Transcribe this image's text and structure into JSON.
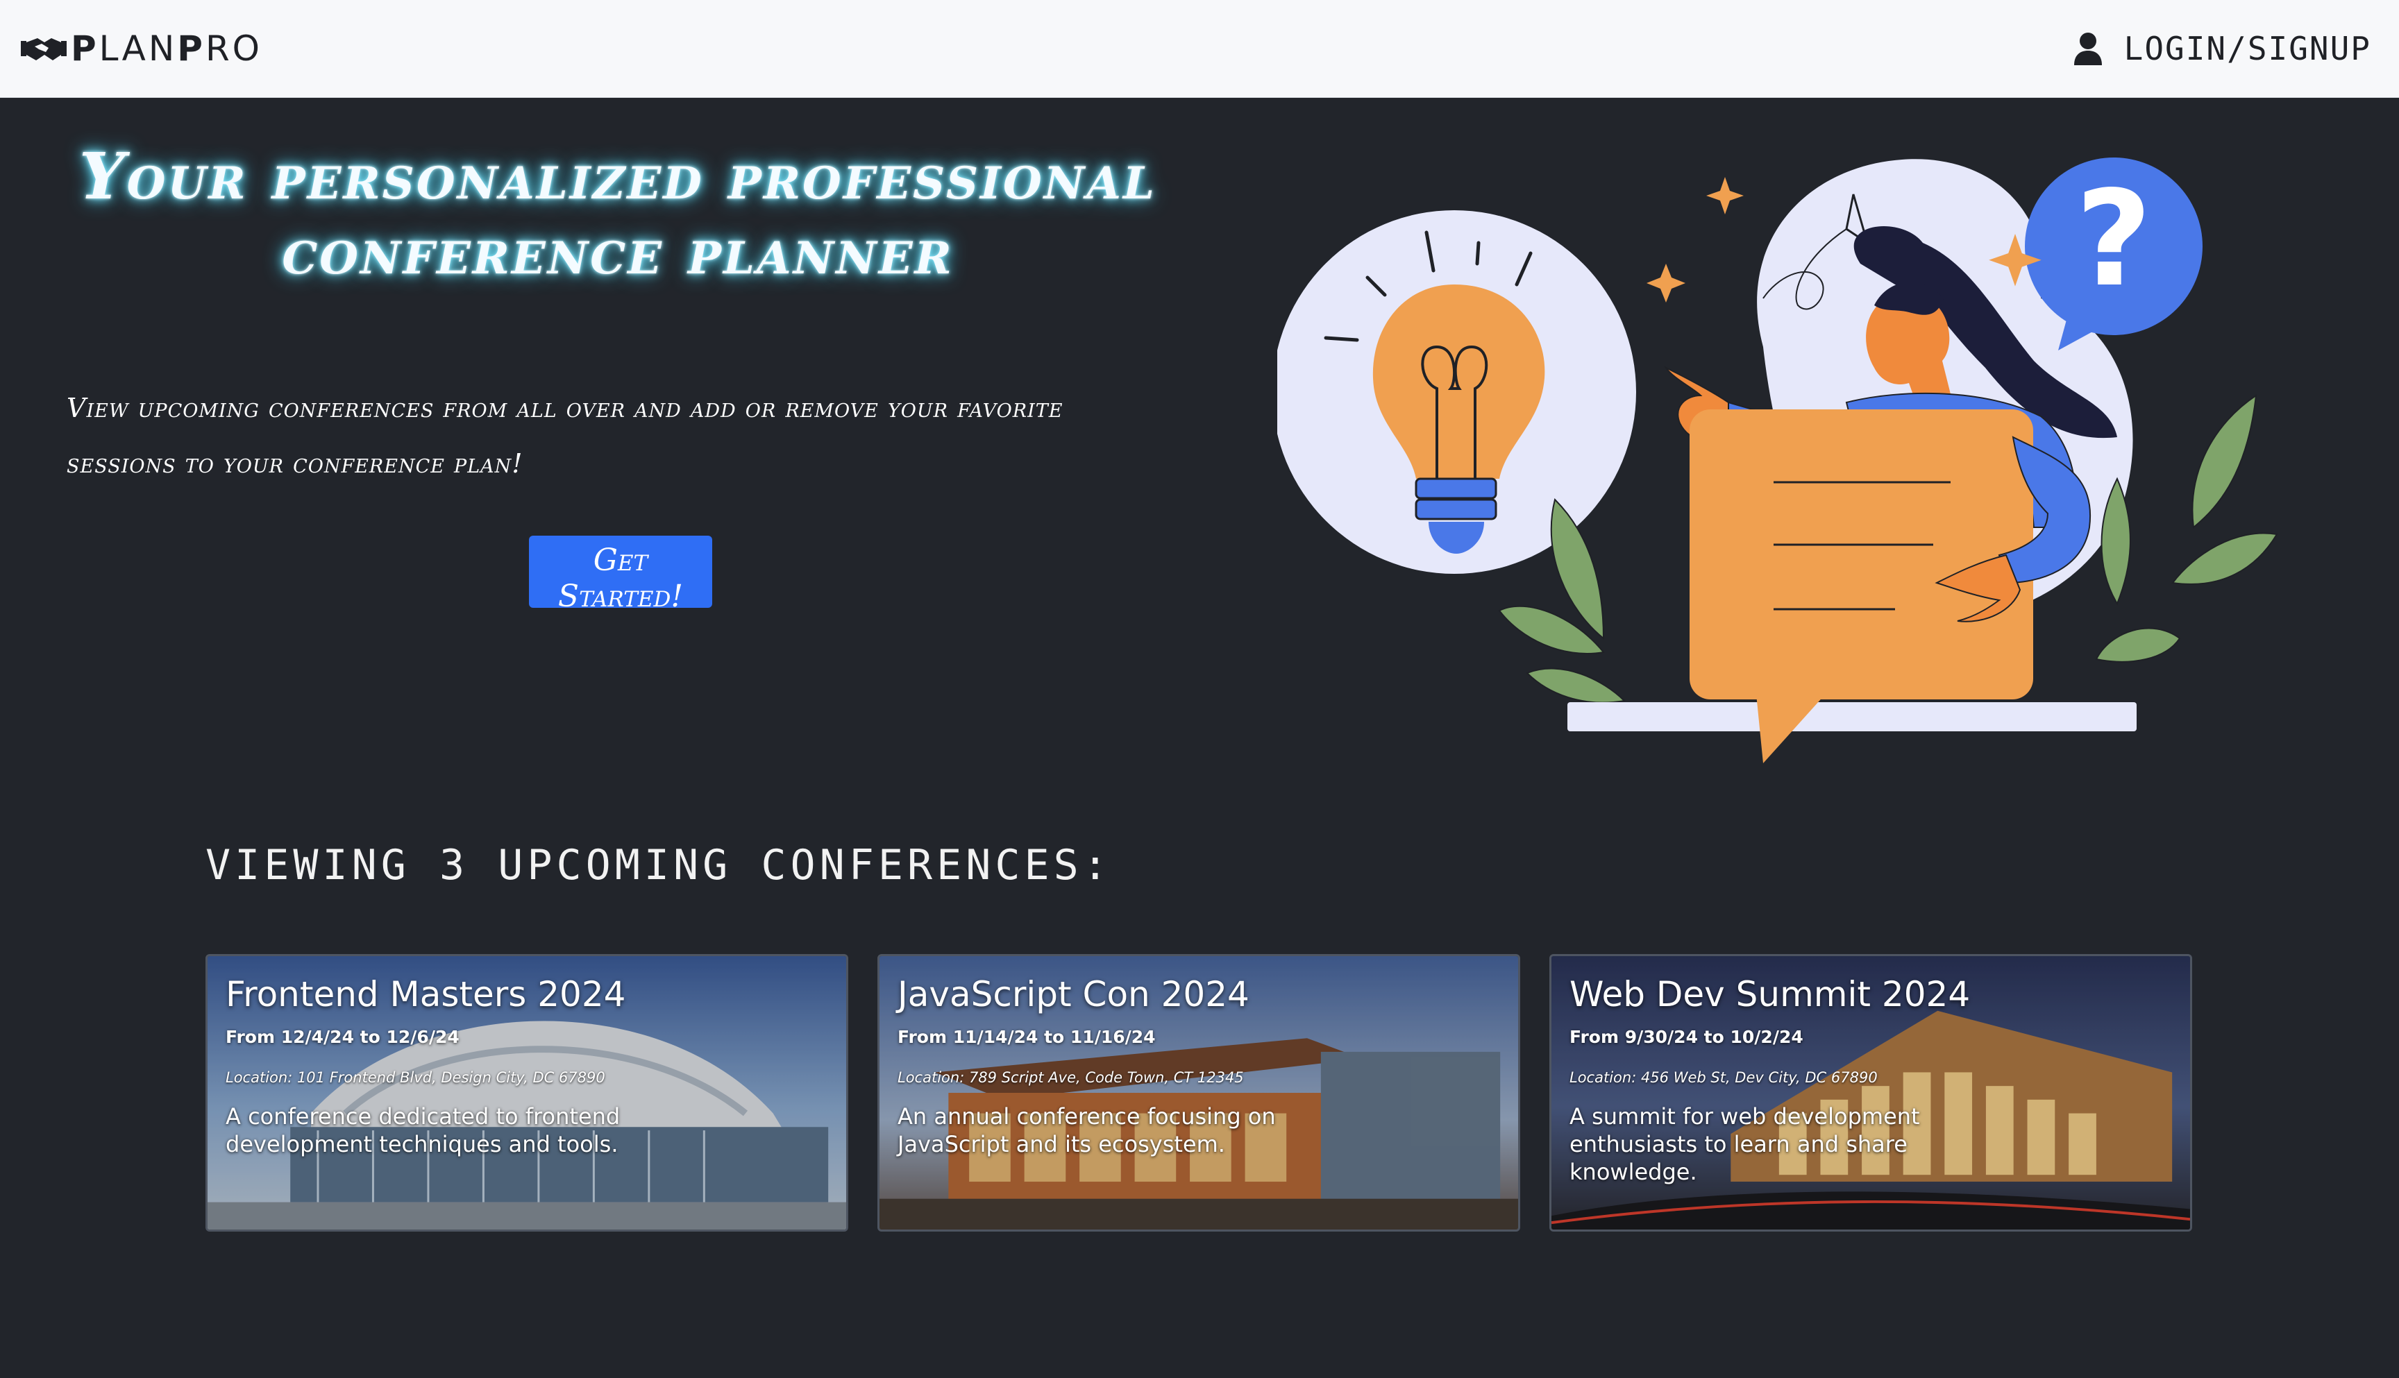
{
  "navbar": {
    "brand_prefix": "P",
    "brand_main": "LAN",
    "brand_suffix_bold": "P",
    "brand_suffix": "RO",
    "login_label": "LOGIN/SIGNUP",
    "brand_icon": "handshake-icon",
    "login_icon": "user-icon"
  },
  "hero": {
    "title": "Your personalized professional conference planner",
    "subtitle": "View upcoming conferences from all over and add or remove your favorite sessions to your conference plan!",
    "cta_label": "Get Started!",
    "illustration": "woman-with-lightbulb-and-question-mark-illustration"
  },
  "conferences_section": {
    "heading": "VIEWING 3 UPCOMING CONFERENCES:"
  },
  "conferences": [
    {
      "title": "Frontend Masters 2024",
      "dates": "From 12/4/24 to 12/6/24",
      "location": "Location: 101 Frontend Blvd, Design City, DC 67890",
      "description": "A conference dedicated to frontend development techniques and tools."
    },
    {
      "title": "JavaScript Con 2024",
      "dates": "From 11/14/24 to 11/16/24",
      "location": "Location: 789 Script Ave, Code Town, CT 12345",
      "description": "An annual conference focusing on JavaScript and its ecosystem."
    },
    {
      "title": "Web Dev Summit 2024",
      "dates": "From 9/30/24 to 10/2/24",
      "location": "Location: 456 Web St, Dev City, DC 67890",
      "description": "A summit for web development enthusiasts to learn and share knowledge."
    }
  ],
  "colors": {
    "page_bg": "#22252b",
    "navbar_bg": "#f7f8fa",
    "cta_blue": "#2f6ef5",
    "title_glow": "#3fd3f5",
    "illustration_orange": "#f0a050",
    "illustration_blue": "#4a78e8",
    "illustration_lavender": "#e6e8fa",
    "leaf_green": "#7fa46a"
  }
}
